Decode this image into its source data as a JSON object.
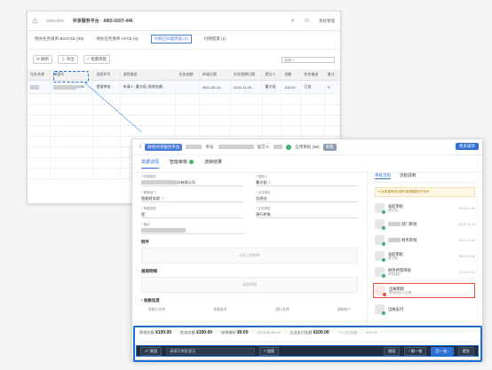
{
  "back_window": {
    "home_icon": "home-icon",
    "logo_text": "welcome",
    "breadcrumb": "共享服务平台 · ABS-0207-446",
    "toolbar_icons": [
      "search-icon",
      "user-icon"
    ],
    "user_label": "系统管理",
    "tabs": [
      "待办任务清单-B0AFCE (99)",
      "待办任务清单-AFCE (0)",
      "付款已办理完成 (2)",
      "付款结束 (1)"
    ],
    "active_tab": 2,
    "tool_buttons": [
      "刷新",
      "导出",
      "批量审批"
    ],
    "search_placeholder": "请输入",
    "table": {
      "columns": [
        "任务名称",
        "单据号",
        "流程环节",
        "流程描述",
        "任务金额",
        "申请日期",
        "任务到期日期",
        "提交人",
        "金额",
        "状态描述",
        "备注"
      ],
      "rows": [
        {
          "cells": [
            "",
            "0250",
            "提报审核...",
            "申请人: 曹文韬, 报销金额...",
            "",
            "2020-09-10...",
            "2020-11-09...",
            "曹文韬",
            "100.00",
            "已批",
            ""
          ]
        }
      ]
    }
  },
  "front_window": {
    "header": {
      "tag": "财务共享服务平台",
      "doc_label": "单号:",
      "amount_label": "提交人:",
      "status_text": "应用审批 (99)",
      "button": "草稿",
      "more": "更多操作"
    },
    "tabs": [
      {
        "label": "单据详情",
        "active": true
      },
      {
        "label": "智能审核",
        "dot": true
      },
      {
        "label": "流转结果"
      }
    ],
    "fields": [
      {
        "label": "* 所属组织",
        "value": "分有限公司"
      },
      {
        "label": "* 报销人",
        "value": "曹文韬",
        "link": true
      },
      {
        "label": "* 报销部门",
        "value": "智能财务部",
        "link": true
      },
      {
        "label": "* 业务单位",
        "value": "总经办"
      },
      {
        "label": "* 单据类型",
        "value": "是"
      },
      {
        "label": "* 业务类型",
        "value": "银行转账"
      },
      {
        "label": "* 事由",
        "value": ""
      }
    ],
    "sections": [
      {
        "title": "附件",
        "placeholder": "点击上传附件"
      },
      {
        "title": "报销明细",
        "placeholder": "添加明细"
      },
      {
        "title": "• 收款信息",
        "columns": [
          "收款方名称",
          "收款账号",
          "银行名称",
          "收款账户"
        ]
      }
    ],
    "side": {
      "tabs": [
        "审批流程",
        "流程说明"
      ],
      "warning": "此单据审批流程可能需要较长时间",
      "nodes": [
        {
          "name": "发起审批",
          "sub": "曹文韬",
          "time": "08-09 11:38",
          "status": "done"
        },
        {
          "name": "部门审批",
          "sub": "",
          "time": "08-10 10:14",
          "status": "done"
        },
        {
          "name": "财务审批",
          "sub": "",
          "time": "08-10 11:42",
          "status": "done"
        },
        {
          "name": "发起审批",
          "sub": "曹文韬",
          "time": "08-09 11:38",
          "status": "done"
        },
        {
          "name": "财务经理审核",
          "sub": "审批通过",
          "time": "10-09 11:12",
          "status": "done"
        },
        {
          "name": "出纳审批",
          "sub": "等待审批人处理",
          "time": "",
          "status": "current"
        },
        {
          "name": "出纳支付",
          "sub": "",
          "time": "",
          "status": "done"
        }
      ]
    },
    "summary": [
      {
        "label": "报销金额",
        "value": "¥100.00"
      },
      {
        "label": "批准金额",
        "value": "¥100.00"
      },
      {
        "label": "核销借款",
        "value": "¥0.00"
      },
      {
        "label": "企业支付金额",
        "value": "¥100.00"
      }
    ],
    "summary_small": [
      "支付比例 (¥0.00)",
      "个人支付金额",
      "¥100.00"
    ],
    "action_bar": {
      "select_label": "驳回",
      "input_placeholder": "请填写审批意见",
      "buttons": [
        "加签",
        "批准",
        "转交审批"
      ],
      "right_buttons": [
        "驳回",
        "前一张",
        "后一张",
        "提交"
      ]
    }
  }
}
